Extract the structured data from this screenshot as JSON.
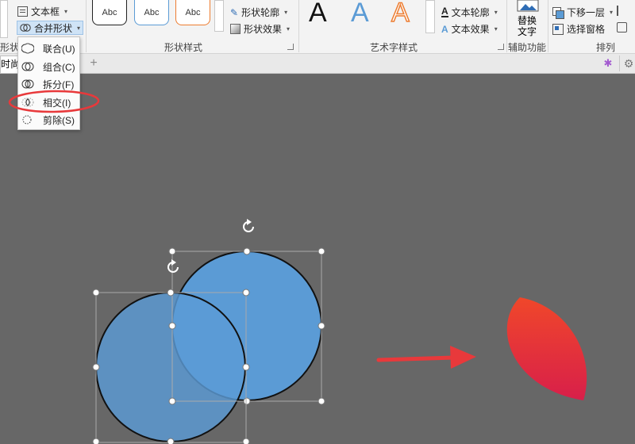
{
  "ribbon": {
    "insert_shapes": {
      "textbox_label": "文本框",
      "merge_shapes_label": "合并形状",
      "group_label_partial": "形状"
    },
    "shape_styles": {
      "group_label": "形状样式",
      "preset_samples": [
        "Abc",
        "Abc",
        "Abc"
      ],
      "outline_label": "形状轮廓",
      "effects_label": "形状效果"
    },
    "wordart_styles": {
      "group_label": "艺术字样式",
      "samples": [
        "A",
        "A",
        "A"
      ],
      "text_outline_label": "文本轮廓",
      "text_effects_label": "文本效果"
    },
    "accessibility": {
      "group_label": "辅助功能",
      "alt_text_line1": "替换",
      "alt_text_line2": "文字"
    },
    "arrange": {
      "group_label": "排列",
      "send_backward_label": "下移一层",
      "selection_pane_label": "选择窗格"
    }
  },
  "merge_menu": {
    "items": [
      {
        "label": "联合(U)"
      },
      {
        "label": "组合(C)"
      },
      {
        "label": "拆分(F)"
      },
      {
        "label": "相交(I)",
        "highlighted": true
      },
      {
        "label": "剪除(S)"
      }
    ]
  },
  "tabs": {
    "active_tab_label": "时尚ppt",
    "add_tab_symbol": "+"
  },
  "colors": {
    "canvas_bg": "#676767",
    "circle_fill": "#5b9bd5",
    "annotation_red": "#e8393b",
    "petal_top": "#f0472a",
    "petal_bottom": "#d81f4a"
  }
}
